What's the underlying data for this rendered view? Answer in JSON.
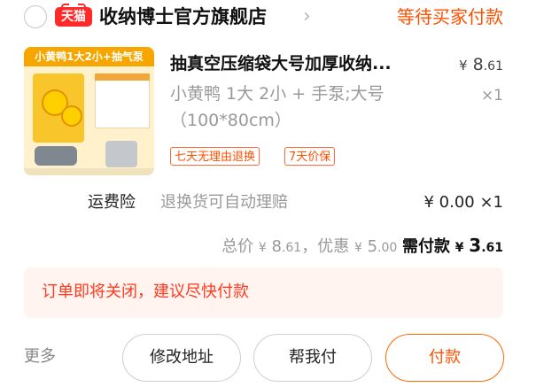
{
  "shop": {
    "badge": "天猫",
    "name": "收纳博士官方旗舰店",
    "status": "等待买家付款"
  },
  "product": {
    "image_banner": "小黄鸭1大2小+抽气泵",
    "title": "抽真空压缩袋大号加厚收纳...",
    "price_symbol": "¥",
    "price_int": "8",
    "price_dec": ".61",
    "spec_line1": "小黄鸭 1大 2小 + 手泵;大号",
    "spec_line2": "（100*80cm）",
    "qty": "×1",
    "tags": [
      "七天无理由退换",
      "7天价保"
    ]
  },
  "insurance": {
    "label": "运费险",
    "desc": "退换货可自动理赔",
    "value": "¥ 0.00 ×1"
  },
  "totals": {
    "total_label": "总价",
    "total_symbol": "¥",
    "total_int": "8",
    "total_dec": ".61",
    "discount_label": "，优惠",
    "discount_symbol": "¥",
    "discount_int": "5",
    "discount_dec": ".00",
    "pay_label": "需付款",
    "pay_symbol": "¥",
    "pay_int": "3",
    "pay_dec": ".61"
  },
  "notice": "订单即将关闭，建议尽快付款",
  "footer": {
    "more": "更多",
    "change_address": "修改地址",
    "help_pay": "帮我付",
    "pay": "付款"
  },
  "colors": {
    "accent": "#ff5000",
    "tmall_red": "#ff2a2a",
    "notice_bg": "#fff4ef",
    "notice_text": "#ff3a1f"
  }
}
